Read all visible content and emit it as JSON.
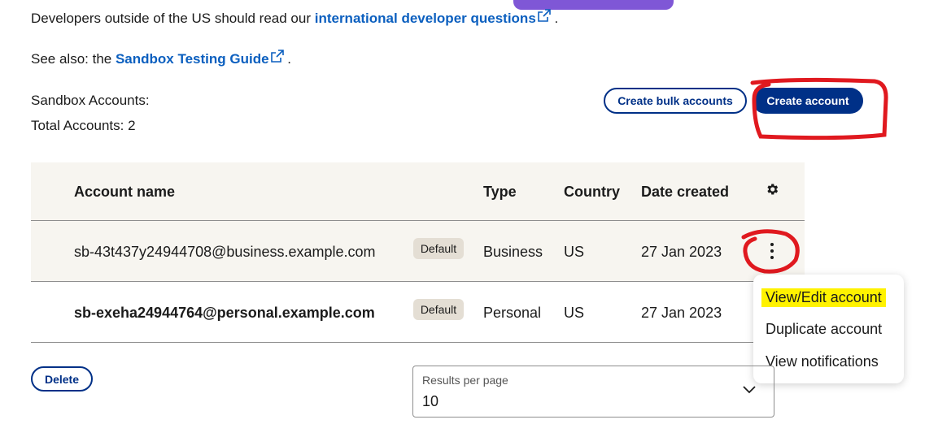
{
  "intro": {
    "intl_prefix": "Developers outside of the US should read our ",
    "intl_link": "international developer questions",
    "intl_suffix": " .",
    "seealso_prefix": "See also: the ",
    "seealso_link": "Sandbox Testing Guide",
    "seealso_suffix": " ."
  },
  "summary": {
    "sandbox_label": "Sandbox Accounts:",
    "total_label": "Total Accounts: 2"
  },
  "actions": {
    "bulk_label": "Create bulk accounts",
    "create_label": "Create account"
  },
  "table": {
    "headers": {
      "account_name": "Account name",
      "type": "Type",
      "country": "Country",
      "date_created": "Date created"
    },
    "rows": [
      {
        "account": "sb-43t437y24944708@business.example.com",
        "badge": "Default",
        "type": "Business",
        "country": "US",
        "date": "27 Jan 2023"
      },
      {
        "account": "sb-exeha24944764@personal.example.com",
        "badge": "Default",
        "type": "Personal",
        "country": "US",
        "date": "27 Jan 2023"
      }
    ]
  },
  "menu": {
    "items": [
      "View/Edit account",
      "Duplicate account",
      "View notifications"
    ],
    "highlight_color": "#fff200"
  },
  "footer": {
    "delete_label": "Delete",
    "rpp_label": "Results per page",
    "rpp_value": "10"
  },
  "colors": {
    "brand": "#003087",
    "link": "#0b5fbf",
    "annotation": "#e0191f"
  },
  "icons": [
    "external-link-icon",
    "gear-icon",
    "kebab-menu-icon",
    "chevron-down-icon"
  ]
}
